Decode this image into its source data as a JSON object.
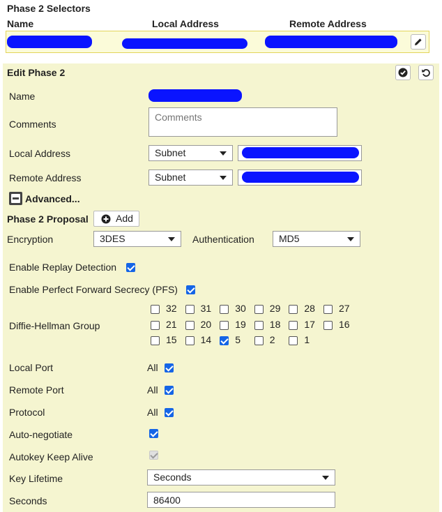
{
  "selectors": {
    "title": "Phase 2 Selectors",
    "col_name": "Name",
    "col_local": "Local Address",
    "col_remote": "Remote Address"
  },
  "edit": {
    "title": "Edit Phase 2",
    "name_label": "Name",
    "comments_label": "Comments",
    "comments_placeholder": "Comments",
    "local_address_label": "Local Address",
    "local_address_type": "Subnet",
    "remote_address_label": "Remote Address",
    "remote_address_type": "Subnet",
    "advanced_label": "Advanced...",
    "proposal_label": "Phase 2 Proposal",
    "add_label": "Add",
    "encryption_label": "Encryption",
    "encryption_value": "3DES",
    "authentication_label": "Authentication",
    "authentication_value": "MD5",
    "replay_label": "Enable Replay Detection",
    "pfs_label": "Enable Perfect Forward Secrecy (PFS)",
    "dh_label": "Diffie-Hellman Group",
    "dh_groups": [
      "32",
      "31",
      "30",
      "29",
      "28",
      "27",
      "21",
      "20",
      "19",
      "18",
      "17",
      "16",
      "15",
      "14",
      "5",
      "2",
      "1"
    ],
    "dh_checked": [
      "5"
    ],
    "local_port_label": "Local Port",
    "remote_port_label": "Remote Port",
    "protocol_label": "Protocol",
    "all_text": "All",
    "autoneg_label": "Auto-negotiate",
    "keepalive_label": "Autokey Keep Alive",
    "key_lifetime_label": "Key Lifetime",
    "key_lifetime_value": "Seconds",
    "seconds_label": "Seconds",
    "seconds_value": "86400"
  },
  "colors": {
    "panel": "#f5f5d0",
    "checkbox": "#1565e6",
    "redaction": "#0a14ff"
  },
  "icons": [
    "pencil-icon",
    "check-circle-icon",
    "undo-icon",
    "minus-box-icon",
    "plus-circle-icon",
    "chevron-down-icon"
  ]
}
